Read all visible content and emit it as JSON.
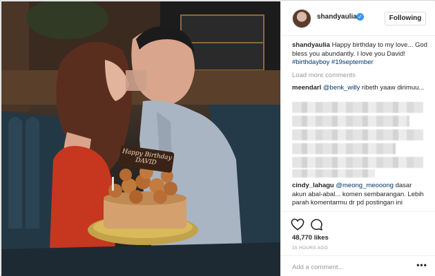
{
  "post": {
    "username": "shandyaulia",
    "verified_icon": "verified-badge-icon",
    "follow_label": "Following",
    "cake_text": "Happy Birthday DAVID"
  },
  "caption": {
    "username": "shandyaulia",
    "text": "Happy birthday to my love... God bless you abundantly. I love you David!",
    "hashtags": "#birthdayboy #19september"
  },
  "load_more_label": "Load more comments",
  "comments": [
    {
      "username": "meendarl",
      "mention": "@benk_willy",
      "text": "ribeth yaaw dirimuu..."
    },
    {
      "username": "cindy_lahagu",
      "mention": "@meong_meooong",
      "text": "dasar akun abal-abal... komen sembarangan. Lebih parah komentarmu dr pd postingan ini"
    }
  ],
  "actions": {
    "like_icon": "heart-icon",
    "comment_icon": "comment-bubble-icon",
    "likes": "48,770 likes",
    "time": "15 HOURS AGO"
  },
  "add_comment": {
    "placeholder": "Add a comment...",
    "more_icon": "more-options-icon",
    "more_label": "•••"
  },
  "colors": {
    "link": "#003569",
    "muted": "#999999",
    "verified": "#3897f0",
    "text": "#262626"
  }
}
